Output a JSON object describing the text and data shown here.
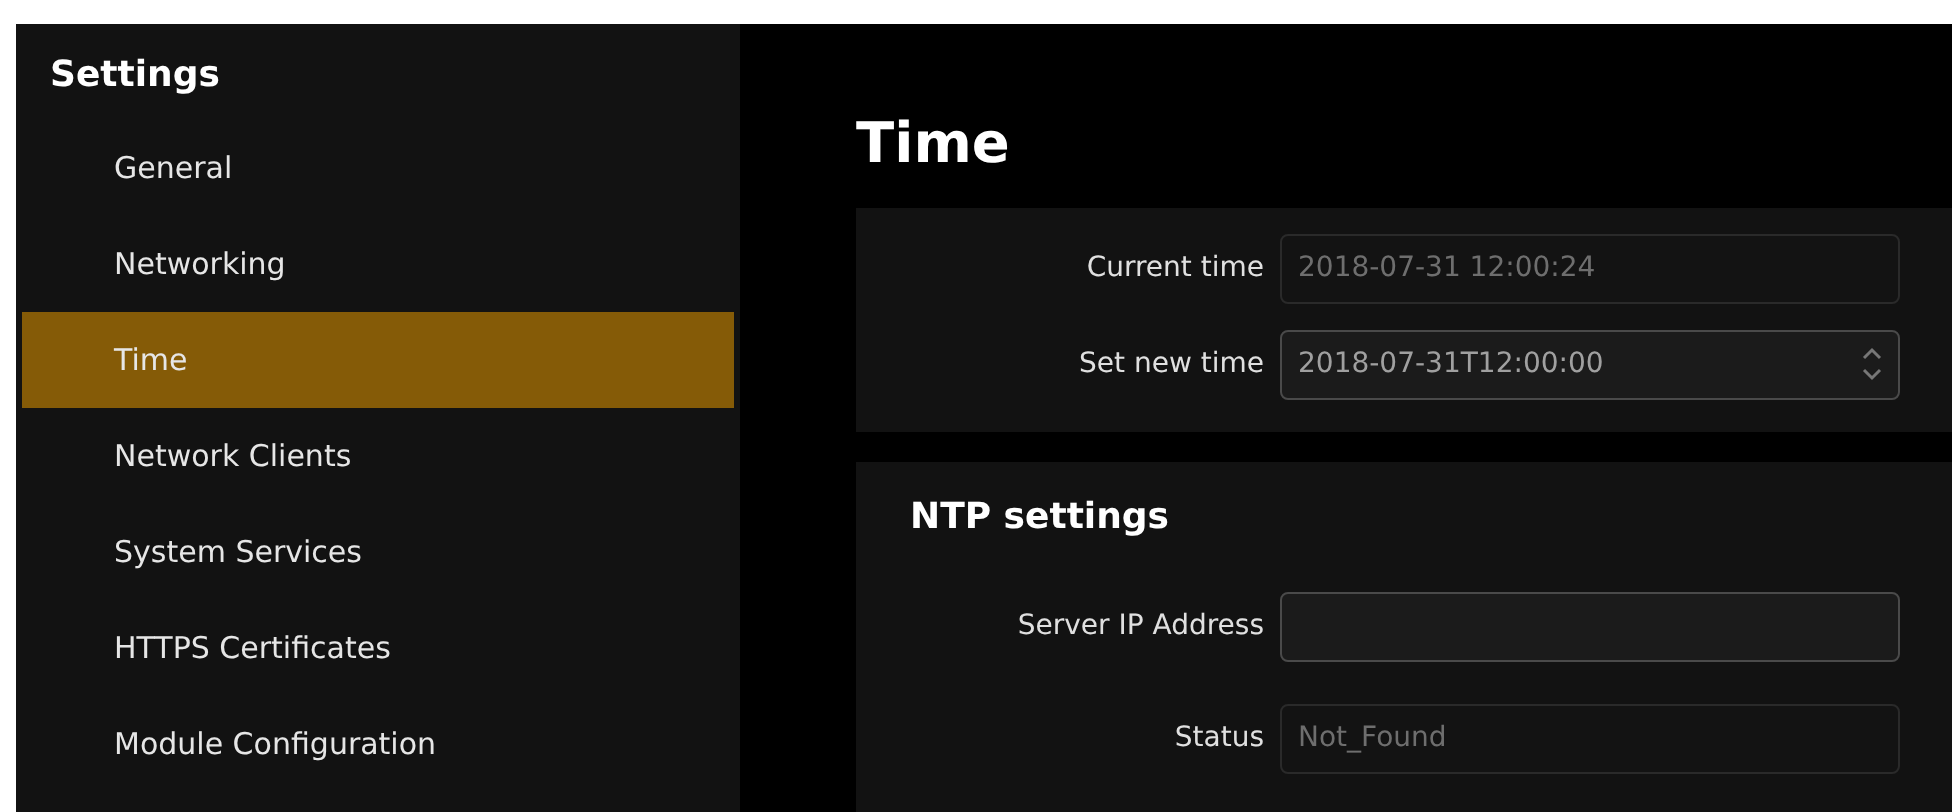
{
  "sidebar": {
    "title": "Settings",
    "items": [
      {
        "label": "General",
        "selected": false
      },
      {
        "label": "Networking",
        "selected": false
      },
      {
        "label": "Time",
        "selected": true
      },
      {
        "label": "Network Clients",
        "selected": false
      },
      {
        "label": "System Services",
        "selected": false
      },
      {
        "label": "HTTPS Certificates",
        "selected": false
      },
      {
        "label": "Module Configuration",
        "selected": false
      }
    ]
  },
  "page_title": "Time",
  "time_panel": {
    "fields": [
      {
        "label": "Current time",
        "value": "2018-07-31 12:00:24",
        "kind": "text",
        "disabled": true
      },
      {
        "label": "Set new time",
        "value": "2018-07-31T12:00:00",
        "kind": "spinner",
        "disabled": false
      }
    ]
  },
  "ntp_panel": {
    "title": "NTP settings",
    "fields": [
      {
        "label": "Server IP Address",
        "kind": "text",
        "disabled": false
      },
      {
        "label": "Status",
        "value": "Not_Found",
        "kind": "text",
        "disabled": true
      }
    ]
  }
}
